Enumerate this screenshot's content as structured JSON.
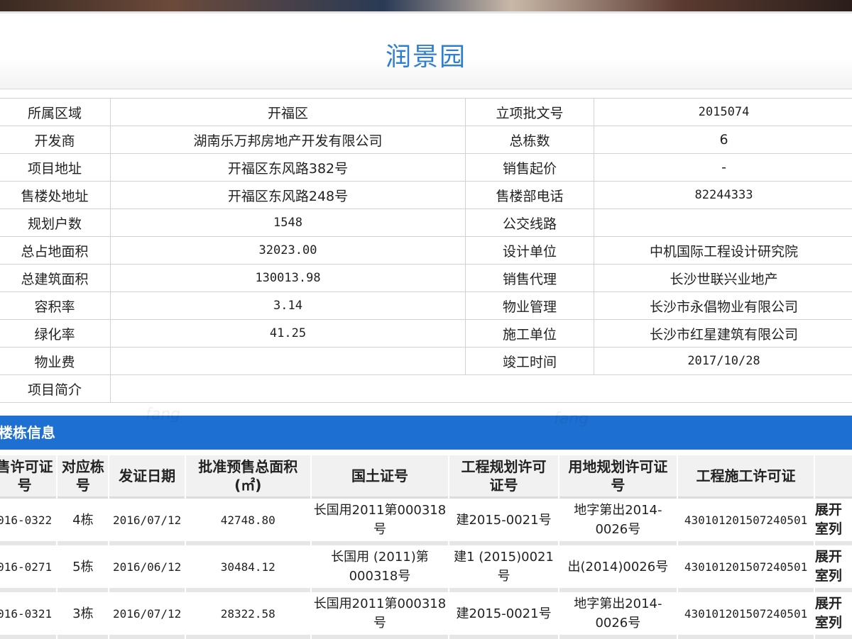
{
  "page": {
    "title": "润景园",
    "section_title": "楼栋信息"
  },
  "info_rows": [
    {
      "label1": "所属区域",
      "value1": "开福区",
      "label2": "立项批文号",
      "value2": "2015074"
    },
    {
      "label1": "开发商",
      "value1": "湖南乐万邦房地产开发有限公司",
      "label2": "总栋数",
      "value2": "6"
    },
    {
      "label1": "项目地址",
      "value1": "开福区东风路382号",
      "label2": "销售起价",
      "value2": "-"
    },
    {
      "label1": "售楼处地址",
      "value1": "开福区东风路248号",
      "label2": "售楼部电话",
      "value2": "82244333"
    },
    {
      "label1": "规划户数",
      "value1": "1548",
      "label2": "公交线路",
      "value2": ""
    },
    {
      "label1": "总占地面积",
      "value1": "32023.00",
      "label2": "设计单位",
      "value2": "中机国际工程设计研究院"
    },
    {
      "label1": "总建筑面积",
      "value1": "130013.98",
      "label2": "销售代理",
      "value2": "长沙世联兴业地产"
    },
    {
      "label1": "容积率",
      "value1": "3.14",
      "label2": "物业管理",
      "value2": "长沙市永倡物业有限公司"
    },
    {
      "label1": "绿化率",
      "value1": "41.25",
      "label2": "施工单位",
      "value2": "长沙市红星建筑有限公司"
    },
    {
      "label1": "物业费",
      "value1": "",
      "label2": "竣工时间",
      "value2": "2017/10/28"
    },
    {
      "label1": "项目简介",
      "value1": ""
    }
  ],
  "building_table": {
    "headers": [
      "售许可证号",
      "对应栋号",
      "发证日期",
      "批准预售总面积(㎡)",
      "国土证号",
      "工程规划许可证号",
      "用地规划许可证号",
      "工程施工许可证",
      ""
    ],
    "header_lines": [
      [
        "售许可证",
        "号"
      ],
      [
        "对应栋",
        "号"
      ],
      [
        "发证日期"
      ],
      [
        "批准预售总面积",
        "(㎡)"
      ],
      [
        "国土证号"
      ],
      [
        "工程规划许可",
        "证号"
      ],
      [
        "用地规划许可证",
        "号"
      ],
      [
        "工程施工许可证"
      ],
      [
        ""
      ]
    ],
    "rows": [
      {
        "permit": "016-0322",
        "building": "4栋",
        "date": "2016/07/12",
        "area": "42748.80",
        "land_cert": [
          "长国用2011第000318",
          "号"
        ],
        "plan_permit": "建2015-0021号",
        "land_plan": [
          "地字第出2014-",
          "0026号"
        ],
        "construct": "430101201507240501",
        "action": [
          "展开",
          "室列"
        ]
      },
      {
        "permit": "016-0271",
        "building": "5栋",
        "date": "2016/06/12",
        "area": "30484.12",
        "land_cert": [
          "长国用 (2011)第",
          "000318号"
        ],
        "plan_permit_lines": [
          "建1 (2015)0021",
          "号"
        ],
        "land_plan_single": "出(2014)0026号",
        "construct": "430101201507240501",
        "action": [
          "展开",
          "室列"
        ]
      },
      {
        "permit": "016-0321",
        "building": "3栋",
        "date": "2016/07/12",
        "area": "28322.58",
        "land_cert": [
          "长国用2011第000318",
          "号"
        ],
        "plan_permit": "建2015-0021号",
        "land_plan": [
          "地字第出2014-",
          "0026号"
        ],
        "construct": "430101201507240501",
        "action": [
          "展开",
          "室列"
        ]
      }
    ]
  }
}
